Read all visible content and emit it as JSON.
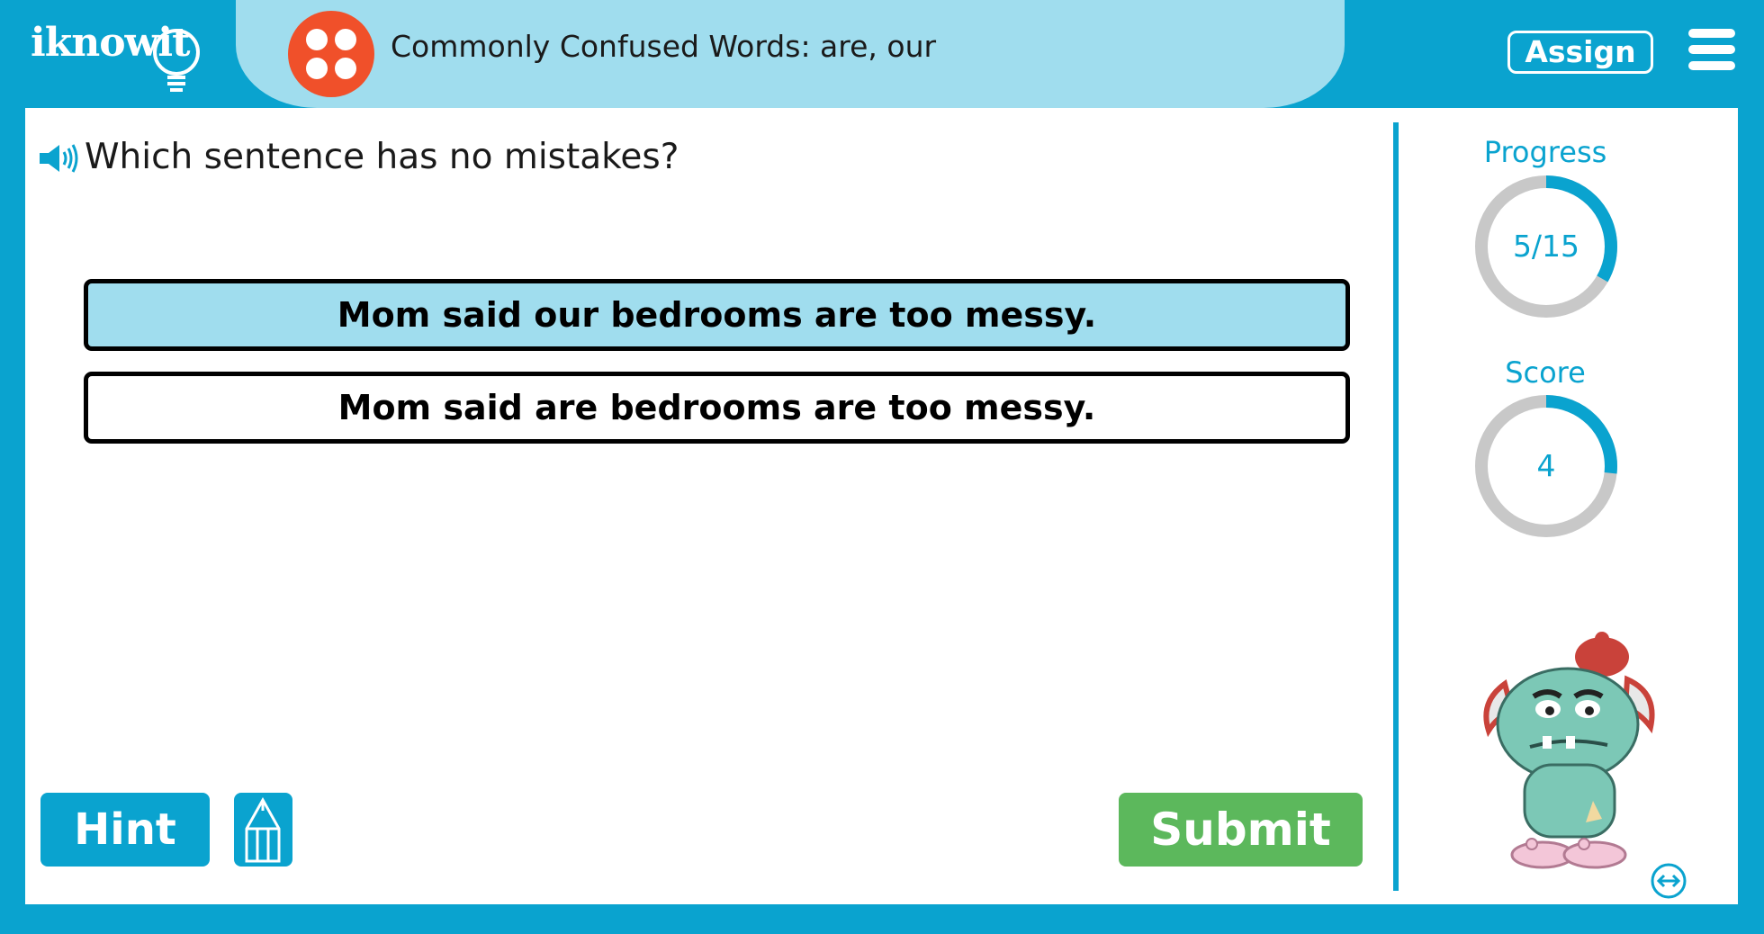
{
  "header": {
    "logo_text": "iknowit",
    "topic_title": "Commonly Confused Words: are, our",
    "assign_label": "Assign"
  },
  "question": {
    "text": "Which sentence has no mistakes?"
  },
  "options": [
    {
      "text": "Mom said our bedrooms are too messy.",
      "selected": true
    },
    {
      "text": "Mom said are bedrooms are too messy.",
      "selected": false
    }
  ],
  "buttons": {
    "hint_label": "Hint",
    "submit_label": "Submit"
  },
  "stats": {
    "progress_label": "Progress",
    "progress_value": "5/15",
    "progress_fraction": 0.333,
    "score_label": "Score",
    "score_value": "4",
    "score_fraction": 0.267
  },
  "colors": {
    "brand_blue": "#0aa3cf",
    "highlight": "#a0ddee",
    "submit_green": "#5cb85c",
    "dice_orange": "#f0502a",
    "ring_gray": "#c8c8c8"
  },
  "icons": [
    "speaker-icon",
    "menu-icon",
    "dice-icon",
    "pencil-icon",
    "swap-icon",
    "lightbulb-icon"
  ]
}
